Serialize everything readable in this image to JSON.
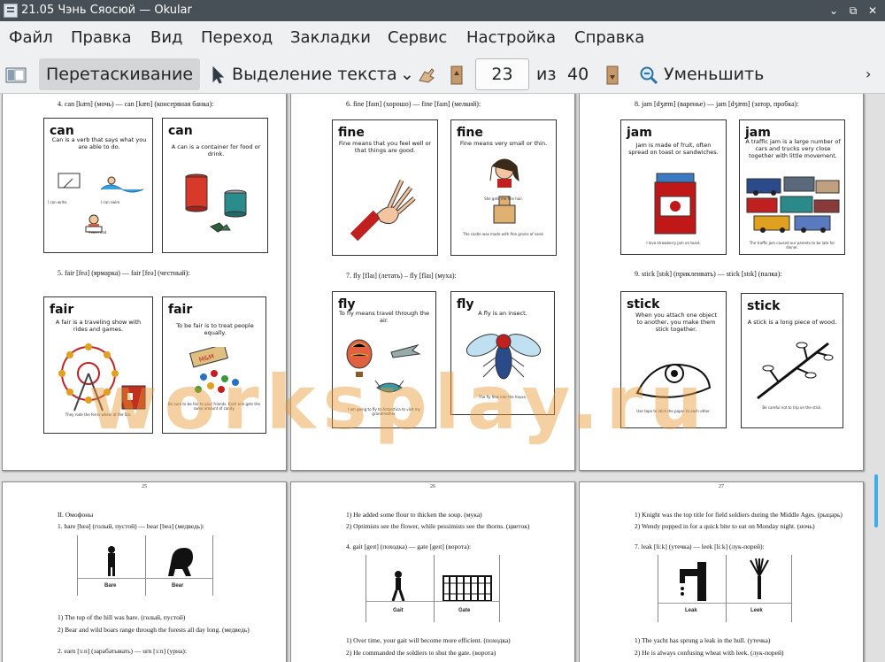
{
  "window": {
    "title": "21.05 Чэнь Сяосюй — Okular",
    "buttons": {
      "minimize": "⌄",
      "maximize": "⧉",
      "close": "✕"
    }
  },
  "menu": [
    "Файл",
    "Правка",
    "Вид",
    "Переход",
    "Закладки",
    "Сервис",
    "Настройка",
    "Справка"
  ],
  "toolbar": {
    "browse": "Перетаскивание",
    "text_select": "Выделение текста",
    "page_current": "23",
    "of_label": "из",
    "page_total": "40",
    "zoom_out": "Уменьшить"
  },
  "watermark": "worksplay.ru",
  "pages": {
    "p22": {
      "caption4": "4. can [kæn] (мочь) — can [kæn] (консервная банка):",
      "card1": {
        "word": "can",
        "def": "Can is a verb that says what you are able to do.",
        "notes": [
          "I can write.",
          "I can swim.",
          "I can read."
        ]
      },
      "card2": {
        "word": "can",
        "def": "A can is a container for food or drink."
      },
      "caption5": "5. fair [feə] (ярмарка) — fair [feə] (честный):",
      "card3": {
        "word": "fair",
        "def": "A fair is a traveling show with rides and games.",
        "note": "They rode the ferris wheel at the fair."
      },
      "card4": {
        "word": "fair",
        "def": "To be fair is to treat people equally.",
        "note": "Be sure to be fair to your friends. Each one gets the same amount of candy."
      }
    },
    "p23": {
      "caption6": "6. fine [faɪn] (хорошо) — fine [faɪn] (мелкий):",
      "card1": {
        "word": "fine",
        "def": "Fine means that you feel well or that things are good."
      },
      "card2": {
        "word": "fine",
        "def": "Fine means very small or thin.",
        "notes": [
          "She gets me fine hair.",
          "The castle was made with fine grains of sand."
        ]
      },
      "caption7": "7. fly [flaɪ] (летать) – fly [flaɪ] (муха):",
      "card3": {
        "word": "fly",
        "def": "To fly means travel through the air.",
        "note": "I am going to fly to Antarctica to visit my grandmother."
      },
      "card4": {
        "word": "fly",
        "def": "A fly is an insect.",
        "note": "The fly flew into the house."
      }
    },
    "p24": {
      "caption8": "8. jam [dʒæm] (варенье) — jam [dʒæm] (затор, пробка):",
      "card1": {
        "word": "jam",
        "def": "Jam is made of fruit, often spread on toast or sandwiches.",
        "note": "I love strawberry jam on toast."
      },
      "card2": {
        "word": "jam",
        "def": "A traffic jam is a large number of cars and trucks very close together with little movement.",
        "note": "The traffic jam caused our parents to be late for dinner."
      },
      "caption9": "9. stick [stɪk] (приклеивать) — stick [stɪk] (палка):",
      "card3": {
        "word": "stick",
        "def": "When you attach one object to another, you make them stick together.",
        "note": "Use tape to stick the paper to each other."
      },
      "card4": {
        "word": "stick",
        "def": "A stick is a long piece of wood.",
        "note": "Be careful not to trip on the stick."
      }
    },
    "p25": {
      "num": "25",
      "heading": "II. Омофоны",
      "item1": "1. bare [beə] (голый, пустой) — bear [beə] (медведь):",
      "label_bare": "Bare",
      "label_bear": "Bear",
      "s1": "1) The top of the hill was bare. (голый, пустой)",
      "s2": "2) Bear and wild boars range through the forests all day long. (медведь)",
      "item2": "2. earn [ɜːn] (зарабатывать) — urn [ɜːn] (урна):"
    },
    "p26": {
      "num": "26",
      "s1": "1) He added some flour to thicken the soup. (мука)",
      "s2": "2) Optimists see the flower, while pessimists see the thorns. (цветок)",
      "item4": "4. gait [geɪt] (походка) — gate [geɪt] (ворота):",
      "label_gait": "Gait",
      "label_gate": "Gate",
      "s3": "1) Over time, your gait will become more efficient. (походка)",
      "s4": "2) He commanded the soldiers to shut the gate. (ворота)"
    },
    "p27": {
      "num": "27",
      "s1": "1) Knight was the top title for field soldiers during the Middle Ages. (рыцарь)",
      "s2": "2) Wendy popped in for a quick bite to eat on Monday night. (ночь)",
      "item7": "7. leak [liːk] (утечка) — leek [liːk] (лук-порей):",
      "label_leak": "Leak",
      "label_leek": "Leek",
      "s3": "1) The yacht has sprung a leak in the hull. (утечка)",
      "s4": "2) He is always confusing wheat with leek. (лук-порей)"
    }
  },
  "colors": {
    "titlebar": "#475057",
    "toolbar": "#eff0f1",
    "accent": "#3daee9",
    "watermark": "#e69632"
  }
}
